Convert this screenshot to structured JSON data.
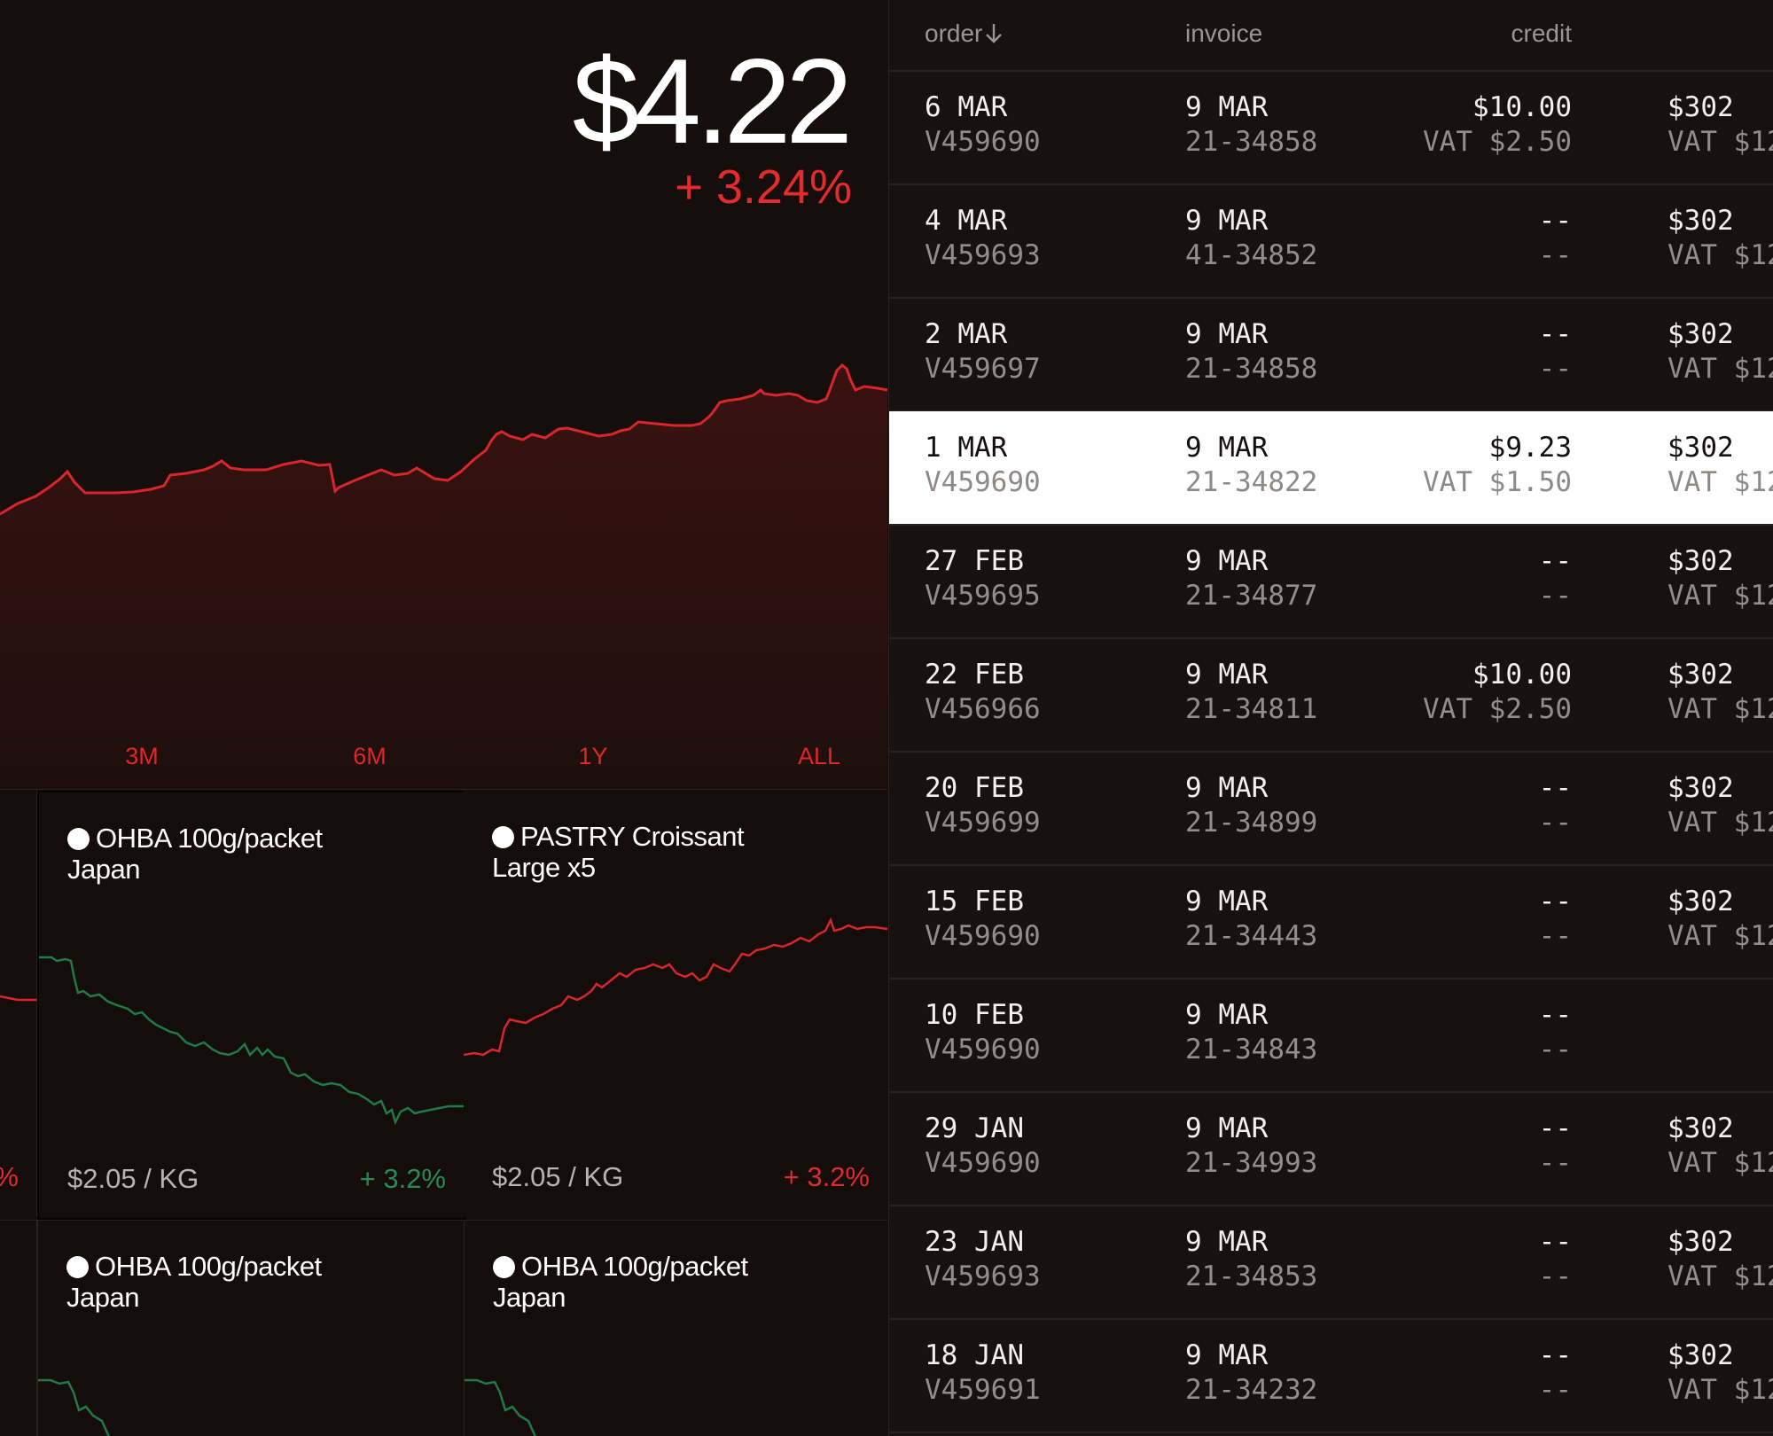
{
  "hero": {
    "price": "$4.22",
    "change": "+ 3.24%",
    "range_buttons": [
      "3M",
      "6M",
      "1Y",
      "ALL"
    ],
    "colors": {
      "line": "#d8262b",
      "fill_top": "#3a1210",
      "background": "#150e0d"
    }
  },
  "cards": [
    {
      "title_line1": "",
      "title_line2": "",
      "price": "",
      "change": "%",
      "trend": "up"
    },
    {
      "title_line1": "OHBA 100g/packet",
      "title_line2": "Japan",
      "price": "$2.05 / KG",
      "change": "+ 3.2%",
      "trend": "down"
    },
    {
      "title_line1": "PASTRY Croissant",
      "title_line2": "Large x5",
      "price": "$2.05 / KG",
      "change": "+ 3.2%",
      "trend": "up"
    },
    {
      "title_line1": "",
      "title_line2": "",
      "price": "",
      "change": "",
      "trend": "down"
    },
    {
      "title_line1": "OHBA 100g/packet",
      "title_line2": "Japan",
      "price": "",
      "change": "",
      "trend": "down"
    },
    {
      "title_line1": "OHBA 100g/packet",
      "title_line2": "Japan",
      "price": "",
      "change": "",
      "trend": "down"
    }
  ],
  "table": {
    "headers": {
      "order": "order",
      "invoice": "invoice",
      "credit": "credit",
      "sort_icon": "arrow-down-icon"
    },
    "rows": [
      {
        "order_date": "6 MAR",
        "order_id": "V459690",
        "invoice_date": "9 MAR",
        "invoice_id": "21-34858",
        "credit": "$10.00",
        "credit_vat": "VAT $2.50",
        "total": "$302",
        "total_vat": "VAT $12",
        "selected": false
      },
      {
        "order_date": "4 MAR",
        "order_id": "V459693",
        "invoice_date": "9 MAR",
        "invoice_id": "41-34852",
        "credit": "--",
        "credit_vat": "--",
        "total": "$302",
        "total_vat": "VAT $12",
        "selected": false
      },
      {
        "order_date": "2 MAR",
        "order_id": "V459697",
        "invoice_date": "9 MAR",
        "invoice_id": "21-34858",
        "credit": "--",
        "credit_vat": "--",
        "total": "$302",
        "total_vat": "VAT $12",
        "selected": false
      },
      {
        "order_date": "1 MAR",
        "order_id": "V459690",
        "invoice_date": "9 MAR",
        "invoice_id": "21-34822",
        "credit": "$9.23",
        "credit_vat": "VAT $1.50",
        "total": "$302",
        "total_vat": "VAT $12",
        "selected": true
      },
      {
        "order_date": "27 FEB",
        "order_id": "V459695",
        "invoice_date": "9 MAR",
        "invoice_id": "21-34877",
        "credit": "--",
        "credit_vat": "--",
        "total": "$302",
        "total_vat": "VAT $12",
        "selected": false
      },
      {
        "order_date": "22 FEB",
        "order_id": "V456966",
        "invoice_date": "9 MAR",
        "invoice_id": "21-34811",
        "credit": "$10.00",
        "credit_vat": "VAT $2.50",
        "total": "$302",
        "total_vat": "VAT $12",
        "selected": false
      },
      {
        "order_date": "20 FEB",
        "order_id": "V459699",
        "invoice_date": "9 MAR",
        "invoice_id": "21-34899",
        "credit": "--",
        "credit_vat": "--",
        "total": "$302",
        "total_vat": "VAT $12",
        "selected": false
      },
      {
        "order_date": "15 FEB",
        "order_id": "V459690",
        "invoice_date": "9 MAR",
        "invoice_id": "21-34443",
        "credit": "--",
        "credit_vat": "--",
        "total": "$302",
        "total_vat": "VAT $12",
        "selected": false
      },
      {
        "order_date": "10 FEB",
        "order_id": "V459690",
        "invoice_date": "9 MAR",
        "invoice_id": "21-34843",
        "credit": "--",
        "credit_vat": "--",
        "total": "",
        "total_vat": "",
        "selected": false
      },
      {
        "order_date": "29 JAN",
        "order_id": "V459690",
        "invoice_date": "9 MAR",
        "invoice_id": "21-34993",
        "credit": "--",
        "credit_vat": "--",
        "total": "$302",
        "total_vat": "VAT $12",
        "selected": false
      },
      {
        "order_date": "23 JAN",
        "order_id": "V459693",
        "invoice_date": "9 MAR",
        "invoice_id": "21-34853",
        "credit": "--",
        "credit_vat": "--",
        "total": "$302",
        "total_vat": "VAT $12",
        "selected": false
      },
      {
        "order_date": "18 JAN",
        "order_id": "V459691",
        "invoice_date": "9 MAR",
        "invoice_id": "21-34232",
        "credit": "--",
        "credit_vat": "--",
        "total": "$302",
        "total_vat": "VAT $12",
        "selected": false
      }
    ]
  }
}
